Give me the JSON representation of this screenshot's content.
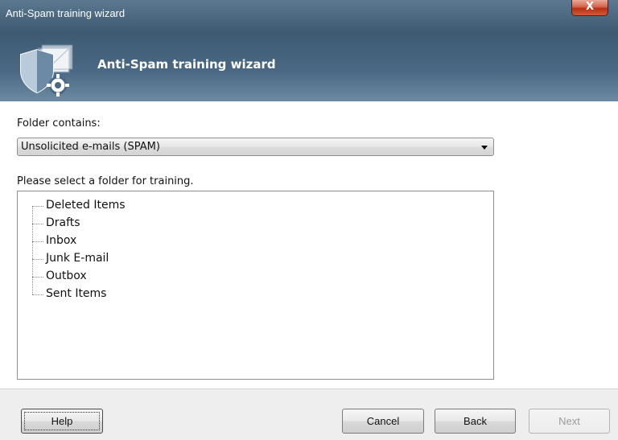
{
  "window": {
    "title": "Anti-Spam training wizard",
    "close_label": "X"
  },
  "header": {
    "title": "Anti-Spam training wizard",
    "logo_icon": "shield-envelope-gear-icon"
  },
  "form": {
    "folder_contains_label": "Folder contains:",
    "folder_contains_value": "Unsolicited e-mails (SPAM)",
    "folder_select_label": "Please select a folder for training.",
    "folders": [
      "Deleted Items",
      "Drafts",
      "Inbox",
      "Junk E-mail",
      "Outbox",
      "Sent Items"
    ]
  },
  "footer": {
    "help_label": "Help",
    "cancel_label": "Cancel",
    "back_label": "Back",
    "next_label": "Next"
  },
  "colors": {
    "titlebar": "#4a6883",
    "close_button": "#c6452a",
    "content_bg": "#ffffff"
  }
}
